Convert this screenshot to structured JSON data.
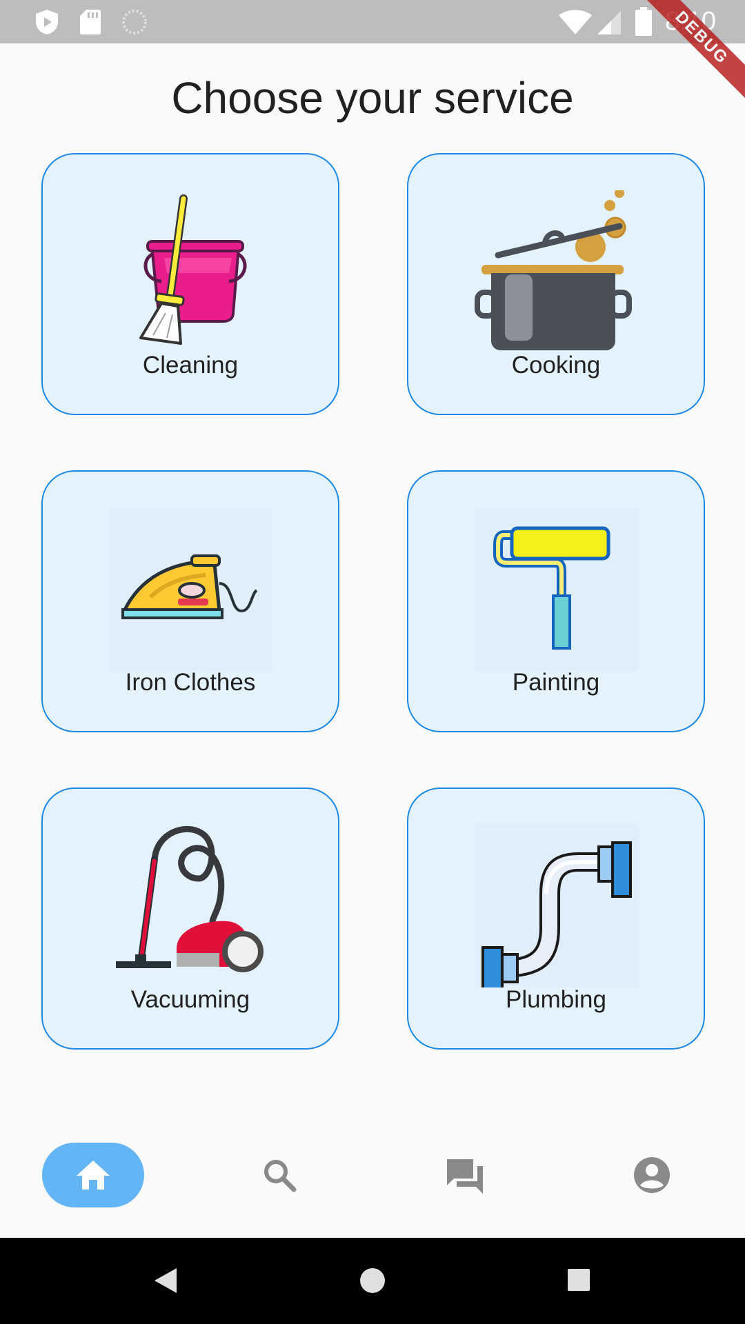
{
  "status_bar": {
    "time": "8:10",
    "icons_left": [
      "play-protect-icon",
      "sd-card-icon",
      "loading-icon"
    ],
    "icons_right": [
      "wifi-icon",
      "signal-icon",
      "battery-icon"
    ]
  },
  "debug_banner": "DEBUG",
  "page": {
    "title": "Choose your service"
  },
  "services": [
    {
      "label": "Cleaning",
      "icon": "cleaning-icon"
    },
    {
      "label": "Cooking",
      "icon": "cooking-pot-icon"
    },
    {
      "label": "Iron Clothes",
      "icon": "iron-icon"
    },
    {
      "label": "Painting",
      "icon": "paint-roller-icon"
    },
    {
      "label": "Vacuuming",
      "icon": "vacuum-cleaner-icon"
    },
    {
      "label": "Plumbing",
      "icon": "pipe-icon"
    }
  ],
  "bottom_nav": {
    "items": [
      {
        "icon": "home-icon",
        "active": true
      },
      {
        "icon": "search-icon",
        "active": false
      },
      {
        "icon": "chat-icon",
        "active": false
      },
      {
        "icon": "account-icon",
        "active": false
      }
    ]
  },
  "colors": {
    "accent": "#64b5f6",
    "card_border": "#1e88e5",
    "card_fill": "#e3f2fd",
    "nav_inactive": "#8a8a8a"
  }
}
